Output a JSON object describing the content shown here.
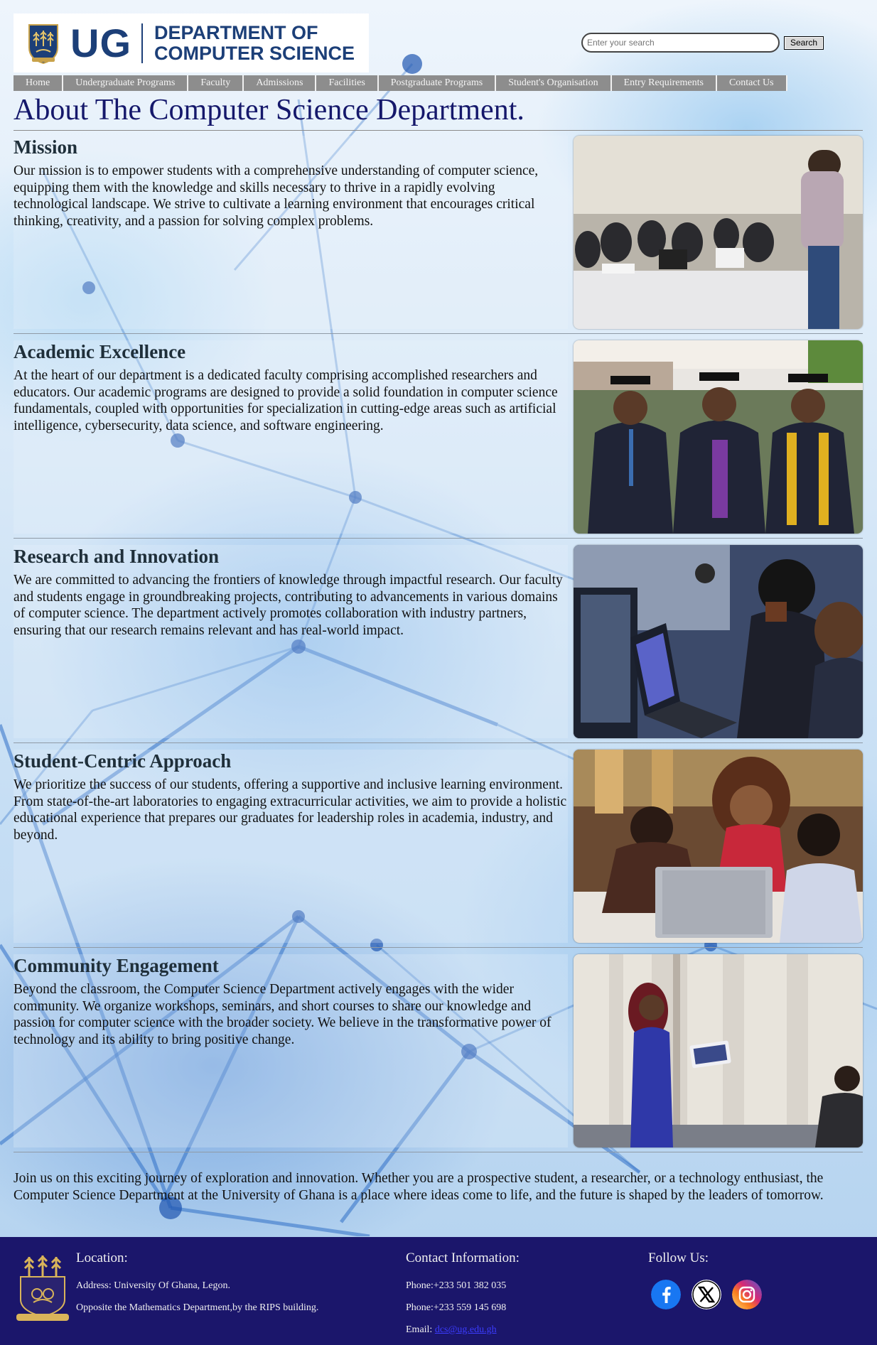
{
  "header": {
    "logo_ug": "UG",
    "logo_dept_line1": "DEPARTMENT OF",
    "logo_dept_line2": "COMPUTER SCIENCE",
    "search_placeholder": "Enter your search",
    "search_button": "Search"
  },
  "nav": [
    "Home",
    "Undergraduate Programs",
    "Faculty",
    "Admissions",
    "Facilities",
    "Postgraduate Programs",
    "Student's Organisation",
    "Entry Requirements",
    "Contact Us"
  ],
  "page_title": "About The Computer Science Department.",
  "sections": [
    {
      "heading": "Mission",
      "body": "Our mission is to empower students with a comprehensive understanding of computer science, equipping them with the knowledge and skills necessary to thrive in a rapidly evolving technological landscape. We strive to cultivate a learning environment that encourages critical thinking, creativity, and a passion for solving complex problems."
    },
    {
      "heading": "Academic Excellence",
      "body": "At the heart of our department is a dedicated faculty comprising accomplished researchers and educators. Our academic programs are designed to provide a solid foundation in computer science fundamentals, coupled with opportunities for specialization in cutting-edge areas such as artificial intelligence, cybersecurity, data science, and software engineering."
    },
    {
      "heading": "Research and Innovation",
      "body": "We are committed to advancing the frontiers of knowledge through impactful research. Our faculty and students engage in groundbreaking projects, contributing to advancements in various domains of computer science. The department actively promotes collaboration with industry partners, ensuring that our research remains relevant and has real-world impact."
    },
    {
      "heading": "Student-Centric Approach",
      "body": "We prioritize the success of our students, offering a supportive and inclusive learning environment. From state-of-the-art laboratories to engaging extracurricular activities, we aim to provide a holistic educational experience that prepares our graduates for leadership roles in academia, industry, and beyond."
    },
    {
      "heading": "Community Engagement",
      "body": "Beyond the classroom, the Computer Science Department actively engages with the wider community. We organize workshops, seminars, and short courses to share our knowledge and passion for computer science with the broader society. We believe in the transformative power of technology and its ability to bring positive change."
    }
  ],
  "closing": "Join us on this exciting journey of exploration and innovation. Whether you are a prospective student, a researcher, or a technology enthusiast, the Computer Science Department at the University of Ghana is a place where ideas come to life, and the future is shaped by the leaders of tomorrow.",
  "footer": {
    "location_heading": "Location:",
    "address": "Address: University Of Ghana, Legon.",
    "landmark": "Opposite the Mathematics Department,by the RIPS building.",
    "contact_heading": "Contact Information:",
    "phone1": "Phone:+233 501 382 035",
    "phone2": "Phone:+233 559 145 698",
    "email_label": "Email:",
    "email": "dcs@ug.edu.gh",
    "follow_heading": "Follow Us:",
    "social_icons": [
      "facebook-icon",
      "x-icon",
      "instagram-icon"
    ]
  },
  "colors": {
    "title": "#15186b",
    "nav_bg": "#8d8d8d",
    "footer_bg": "#1b166b",
    "logo_blue": "#1c3f78"
  }
}
